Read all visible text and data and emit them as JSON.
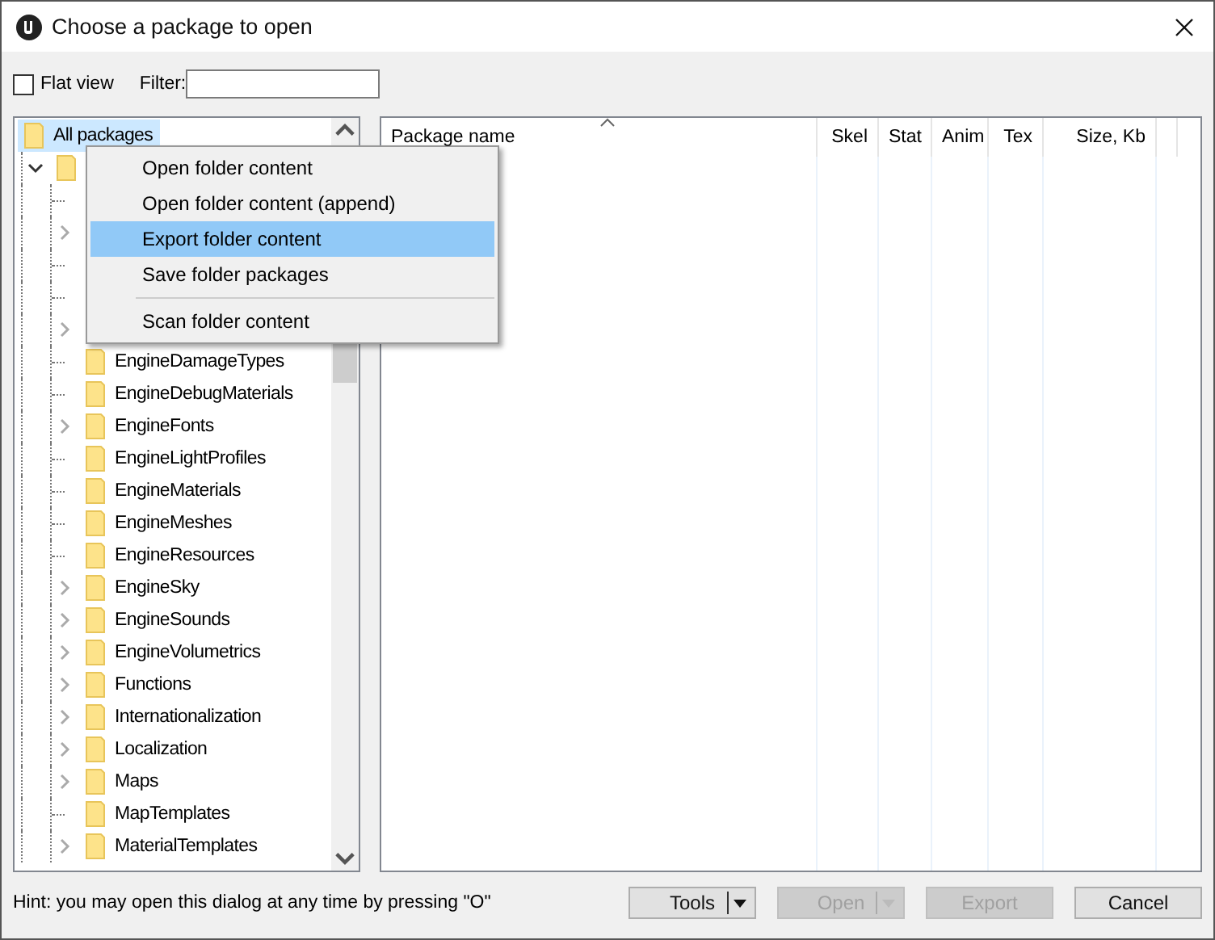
{
  "window": {
    "title": "Choose a package to open"
  },
  "toolbar": {
    "flat_view": {
      "label": "Flat view",
      "checked": false
    },
    "filter": {
      "label": "Filter:"
    }
  },
  "tree": [
    {
      "label": "All packages",
      "selected": true,
      "children": [
        {
          "selected": false,
          "expanded": true,
          "children": [
            {
              "kind": "leaf"
            },
            {
              "kind": "folder",
              "expanded": false
            },
            {
              "kind": "leaf"
            },
            {
              "kind": "leaf"
            },
            {
              "kind": "folder",
              "expanded": false
            },
            {
              "label": "EngineDamageTypes",
              "selected": false
            },
            {
              "label": "EngineDebugMaterials",
              "selected": false
            },
            {
              "label": "EngineFonts",
              "selected": false,
              "expanded": false
            },
            {
              "label": "EngineLightProfiles",
              "selected": false
            },
            {
              "label": "EngineMaterials",
              "selected": false
            },
            {
              "label": "EngineMeshes",
              "selected": false
            },
            {
              "label": "EngineResources",
              "selected": false
            },
            {
              "label": "EngineSky",
              "selected": false,
              "expanded": false
            },
            {
              "label": "EngineSounds",
              "selected": false,
              "expanded": false
            },
            {
              "label": "EngineVolumetrics",
              "selected": false,
              "expanded": false
            },
            {
              "label": "Functions",
              "selected": false,
              "expanded": false
            },
            {
              "label": "Internationalization",
              "selected": false,
              "expanded": false
            },
            {
              "label": "Localization",
              "selected": false,
              "expanded": false
            },
            {
              "label": "Maps",
              "selected": false,
              "expanded": false
            },
            {
              "label": "MapTemplates",
              "selected": false
            },
            {
              "label": "MaterialTemplates",
              "selected": false,
              "expanded": false
            }
          ]
        }
      ]
    }
  ],
  "context_menu": [
    {
      "kind": "item",
      "label": "Open folder content",
      "selected": false
    },
    {
      "kind": "item",
      "label": "Open folder content (append)",
      "selected": false
    },
    {
      "kind": "item",
      "label": "Export folder content",
      "selected": true
    },
    {
      "kind": "item",
      "label": "Save folder packages",
      "selected": false
    },
    {
      "kind": "separator"
    },
    {
      "kind": "item",
      "label": "Scan folder content",
      "selected": false
    }
  ],
  "table": {
    "columns": [
      "Package name",
      "Skel",
      "Stat",
      "Anim",
      "Tex",
      "Size, Kb"
    ]
  },
  "hint": "Hint: you may open this dialog at any time by pressing \"O\"",
  "buttons": [
    {
      "label": "Tools",
      "disabled": false,
      "dropdown": true
    },
    {
      "label": "Open",
      "disabled": true,
      "dropdown": true
    },
    {
      "label": "Export",
      "disabled": true,
      "dropdown": false
    },
    {
      "label": "Cancel",
      "disabled": false,
      "dropdown": false
    }
  ]
}
